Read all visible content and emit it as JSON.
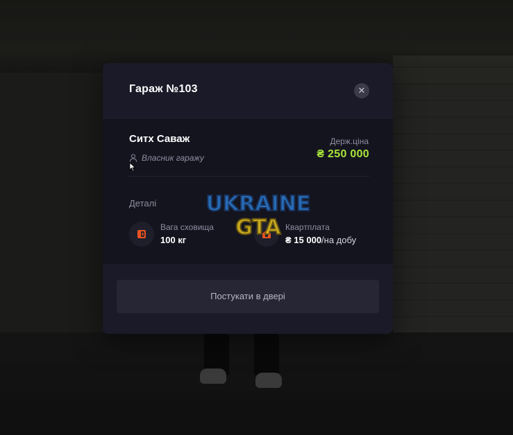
{
  "modal": {
    "title": "Гараж №103",
    "close_icon": "close-icon"
  },
  "owner": {
    "name": "Ситх Саваж",
    "role": "Власник гаражу",
    "role_icon": "person-icon"
  },
  "price": {
    "label": "Держ.ціна",
    "value": "₴ 250 000",
    "color": "#a9e63a"
  },
  "details": {
    "label": "Деталі",
    "items": [
      {
        "icon": "storage-icon",
        "label": "Вага сховища",
        "value": "100 кг",
        "suffix": ""
      },
      {
        "icon": "house-icon",
        "label": "Квартплата",
        "value": "₴ 15 000",
        "suffix": "/на добу"
      }
    ]
  },
  "actions": {
    "knock_label": "Постукати в двері"
  },
  "watermark": {
    "line1": "UKRAINE",
    "line2": "GTA"
  },
  "colors": {
    "accent_icon": "#e8531f",
    "panel": "#14141f"
  }
}
